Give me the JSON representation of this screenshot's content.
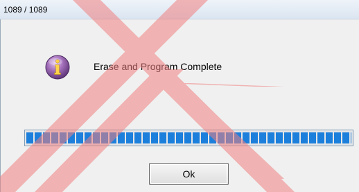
{
  "window": {
    "title": "1089 / 1089"
  },
  "dialog": {
    "icon": "info-icon",
    "message": "Erase and Program Complete",
    "progress_fraction": 1.0,
    "ok_label": "Ok"
  },
  "colors": {
    "progress_fill": "#1c7fdc",
    "icon_purple": "#8d5aa6",
    "watermark": "#f08080"
  }
}
